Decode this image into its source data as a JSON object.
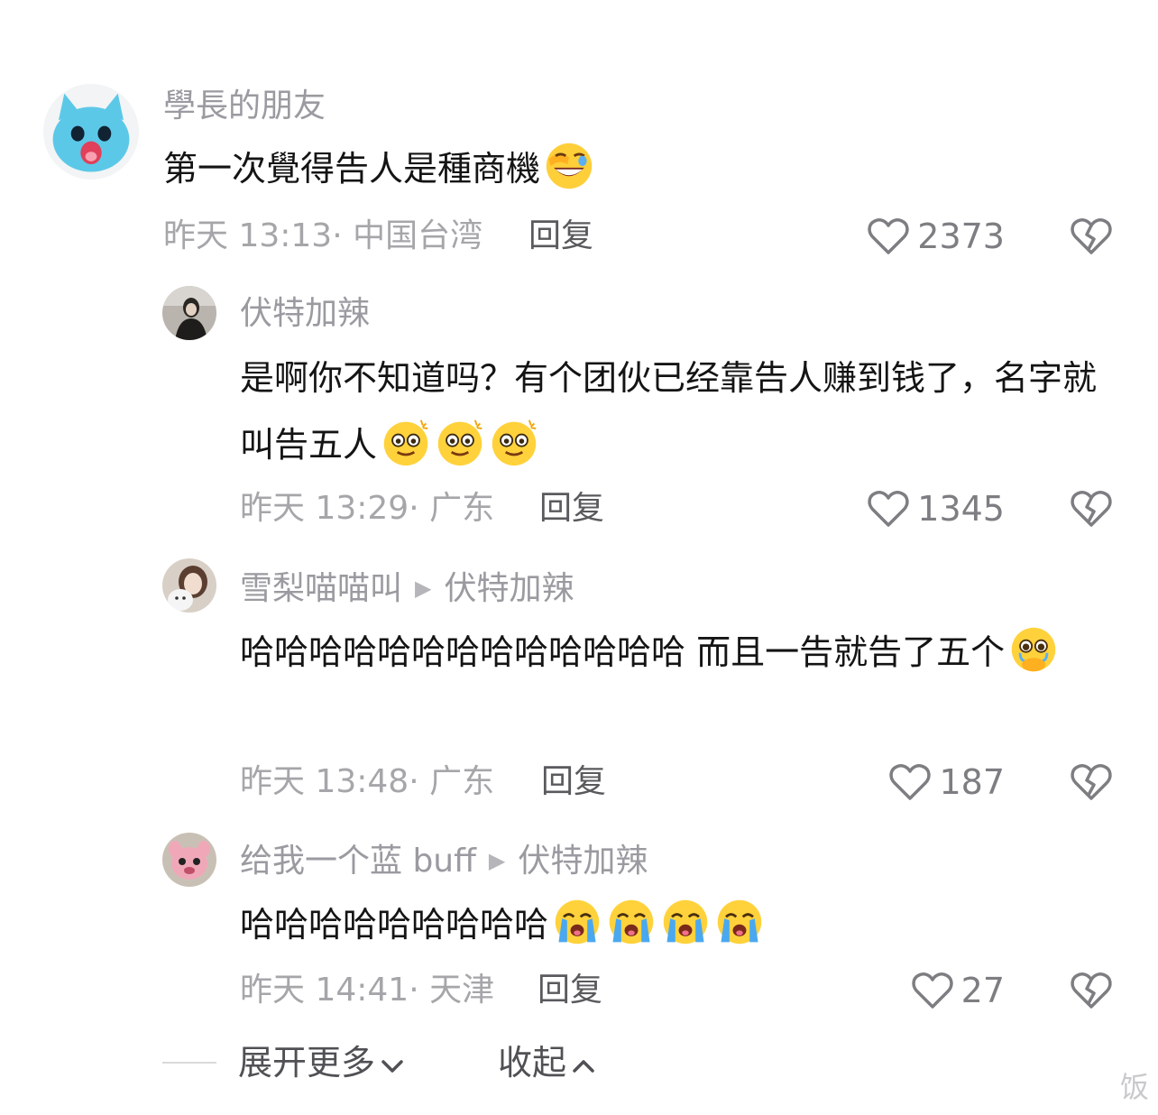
{
  "comments": [
    {
      "author": "學長的朋友",
      "reply_to": "",
      "text": "第一次覺得告人是種商機",
      "time_location": "昨天 13:13· 中国台湾",
      "reply_label": "回复",
      "likes": "2373",
      "emoji": [
        "face-with-hand-laughing-icon"
      ]
    },
    {
      "author": "伏特加辣",
      "reply_to": "",
      "text": "是啊你不知道吗？有个团伙已经靠告人赚到钱了，名字就叫告五人",
      "time_location": "昨天 13:29· 广东",
      "reply_label": "回复",
      "likes": "1345",
      "emoji": [
        "dizzy-eyes-face-icon",
        "dizzy-eyes-face-icon",
        "dizzy-eyes-face-icon"
      ]
    },
    {
      "author": "雪梨喵喵叫",
      "reply_to": "伏特加辣",
      "text": "哈哈哈哈哈哈哈哈哈哈哈哈哈 而且一告就告了五个",
      "time_location": "昨天 13:48· 广东",
      "reply_label": "回复",
      "likes": "187",
      "emoji": [
        "holding-back-tears-face-icon"
      ]
    },
    {
      "author": "给我一个蓝 buff",
      "reply_to": "伏特加辣",
      "text": "哈哈哈哈哈哈哈哈哈",
      "time_location": "昨天 14:41· 天津",
      "reply_label": "回复",
      "likes": "27",
      "emoji": [
        "loudly-crying-face-icon",
        "loudly-crying-face-icon",
        "loudly-crying-face-icon",
        "loudly-crying-face-icon"
      ]
    }
  ],
  "footer": {
    "expand_label": "展开更多",
    "collapse_label": "收起"
  },
  "watermark": "饭"
}
